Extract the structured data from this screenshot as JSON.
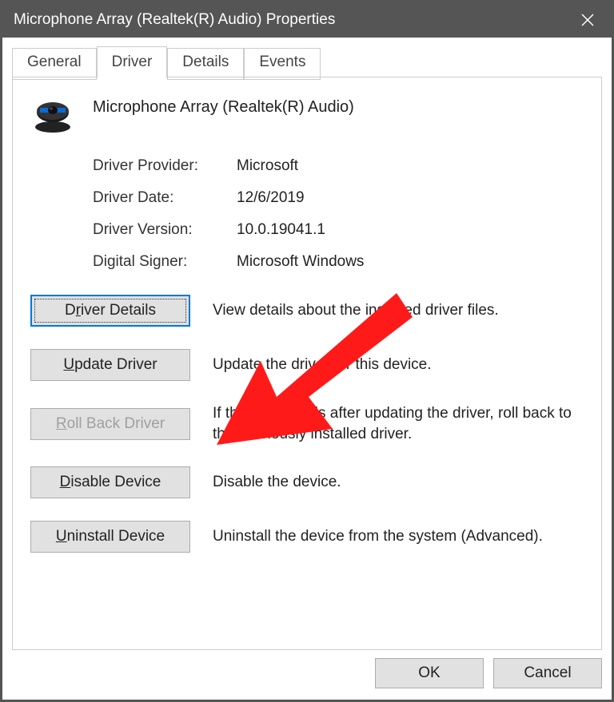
{
  "titlebar": {
    "title": "Microphone Array (Realtek(R) Audio) Properties"
  },
  "tabs": [
    {
      "label": "General",
      "active": false
    },
    {
      "label": "Driver",
      "active": true
    },
    {
      "label": "Details",
      "active": false
    },
    {
      "label": "Events",
      "active": false
    }
  ],
  "device": {
    "name": "Microphone Array (Realtek(R) Audio)",
    "icon": "webcam-icon"
  },
  "info": {
    "provider_label": "Driver Provider:",
    "provider_value": "Microsoft",
    "date_label": "Driver Date:",
    "date_value": "12/6/2019",
    "version_label": "Driver Version:",
    "version_value": "10.0.19041.1",
    "signer_label": "Digital Signer:",
    "signer_value": "Microsoft Windows"
  },
  "actions": {
    "driver_details": {
      "pre": "D",
      "mn": "r",
      "post": "iver Details",
      "desc": "View details about the installed driver files.",
      "disabled": false,
      "focused": true
    },
    "update_driver": {
      "pre": "",
      "mn": "U",
      "post": "pdate Driver",
      "desc": "Update the driver for this device.",
      "disabled": false,
      "focused": false
    },
    "rollback_driver": {
      "pre": "",
      "mn": "R",
      "post": "oll Back Driver",
      "desc": "If the device fails after updating the driver, roll back to the previously installed driver.",
      "disabled": true,
      "focused": false
    },
    "disable_device": {
      "pre": "",
      "mn": "D",
      "post": "isable Device",
      "desc": "Disable the device.",
      "disabled": false,
      "focused": false
    },
    "uninstall_device": {
      "pre": "",
      "mn": "U",
      "post": "ninstall Device",
      "desc": "Uninstall the device from the system (Advanced).",
      "disabled": false,
      "focused": false
    }
  },
  "bottom": {
    "ok_label": "OK",
    "cancel_label": "Cancel"
  },
  "annotation": {
    "arrow_color": "#ff1a1a"
  }
}
